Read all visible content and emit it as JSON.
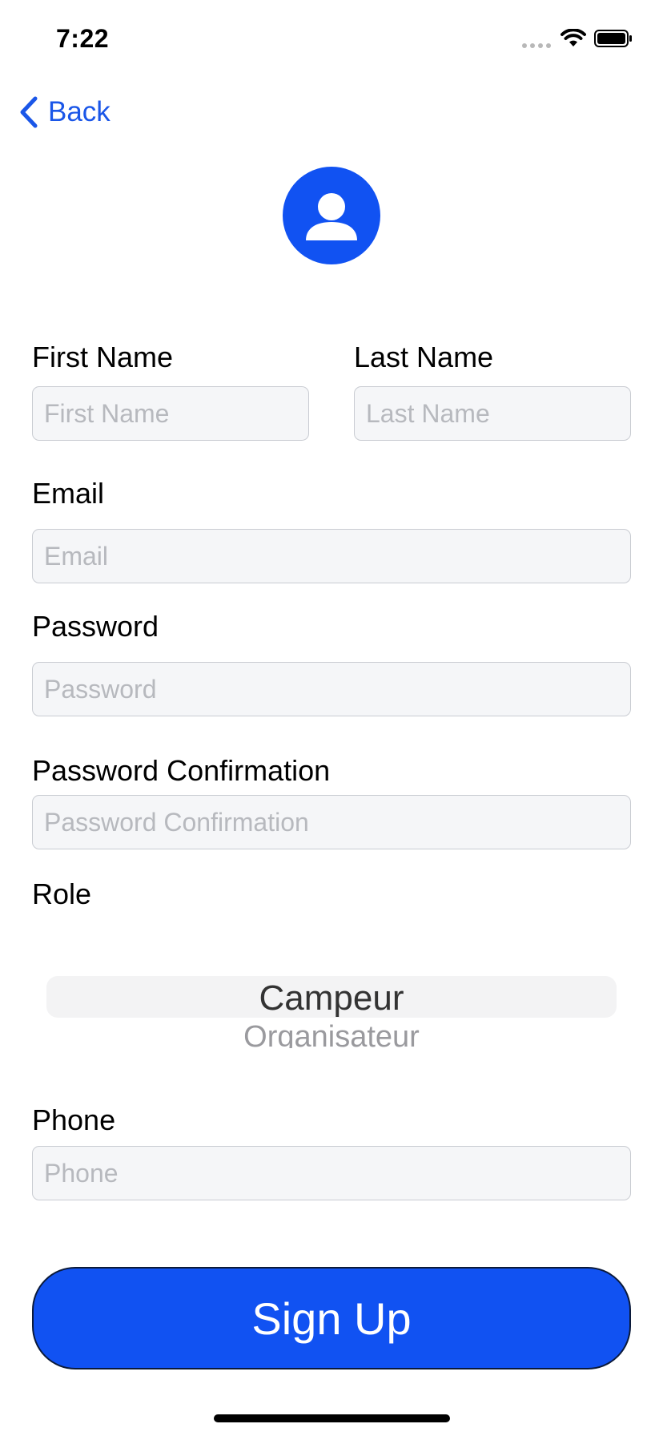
{
  "status_bar": {
    "time": "7:22",
    "icons": [
      "signal-dots-icon",
      "wifi-icon",
      "battery-icon"
    ]
  },
  "nav": {
    "back_label": "Back",
    "back_icon": "chevron-left-icon",
    "accent_color": "#1a56e8"
  },
  "avatar": {
    "icon": "person-icon",
    "color": "#1152f2"
  },
  "form": {
    "first_name": {
      "label": "First Name",
      "placeholder": "First Name",
      "value": ""
    },
    "last_name": {
      "label": "Last Name",
      "placeholder": "Last Name",
      "value": ""
    },
    "email": {
      "label": "Email",
      "placeholder": "Email",
      "value": ""
    },
    "password": {
      "label": "Password",
      "placeholder": "Password",
      "value": ""
    },
    "password_confirmation": {
      "label": "Password Confirmation",
      "placeholder": "Password Confirmation",
      "value": ""
    },
    "role": {
      "label": "Role",
      "selected": "Campeur",
      "next_option": "Organisateur"
    },
    "phone": {
      "label": "Phone",
      "placeholder": "Phone",
      "value": ""
    }
  },
  "actions": {
    "signup_label": "Sign Up",
    "signup_color": "#1152f2"
  }
}
